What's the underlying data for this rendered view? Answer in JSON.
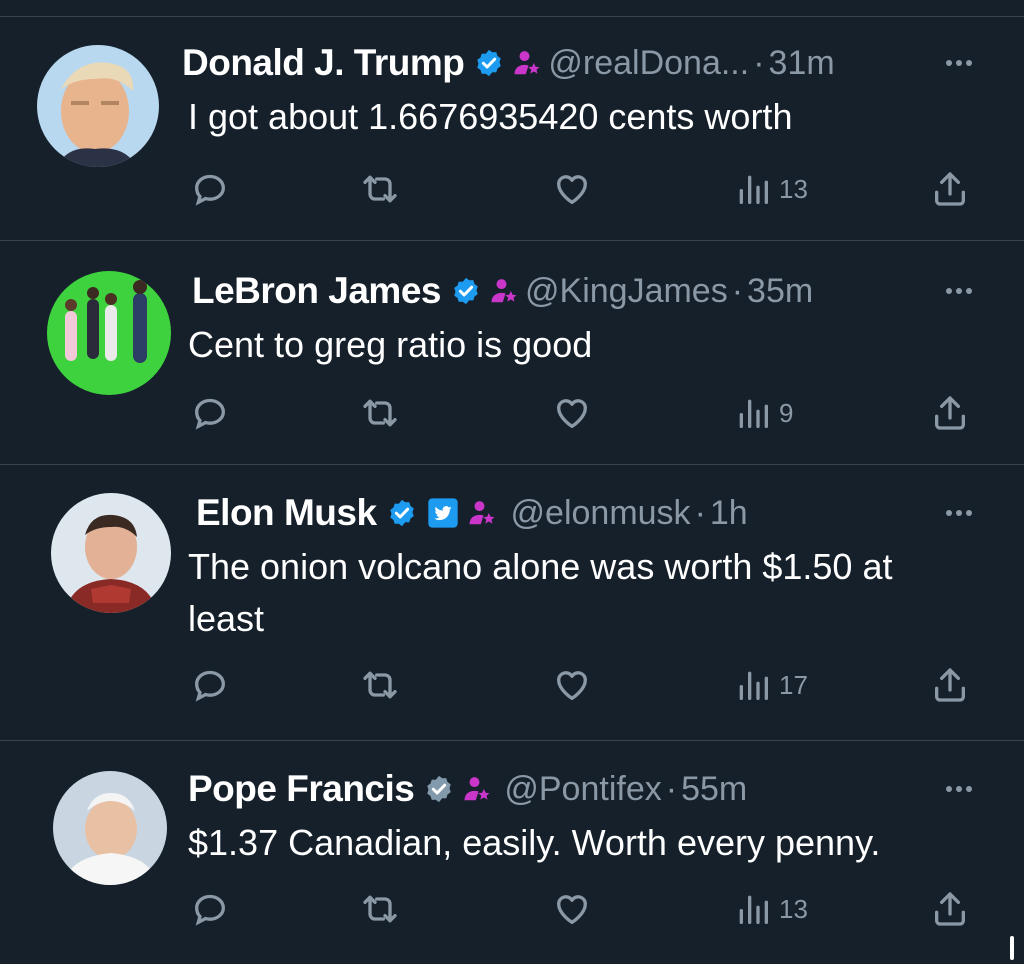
{
  "tweets": [
    {
      "name": "Donald J. Trump",
      "handle": "@realDona...",
      "separator": "·",
      "time": "31m",
      "text": "I got about 1.6676935420 cents worth",
      "views": "13",
      "avatar": "portrait-man-light-blue-background",
      "badge_color": "#1d9bf0"
    },
    {
      "name": "LeBron James",
      "handle": "@KingJames",
      "separator": "·",
      "time": "35m",
      "text": "Cent to greg ratio is good",
      "views": "9",
      "avatar": "group-photo-green-background",
      "badge_color": "#1d9bf0"
    },
    {
      "name": "Elon Musk",
      "handle": "@elonmusk",
      "separator": "·",
      "time": "1h",
      "text": "The onion volcano alone was worth $1.50 at least",
      "views": "17",
      "avatar": "portrait-man-red-armor",
      "badge_color": "#1d9bf0"
    },
    {
      "name": "Pope Francis",
      "handle": "@Pontifex",
      "separator": "·",
      "time": "55m",
      "text": "$1.37 Canadian, easily. Worth every penny.",
      "views": "13",
      "avatar": "portrait-pope-white-cap",
      "badge_color": "#829aab"
    }
  ],
  "icons": {
    "verified": "verified-badge-icon",
    "affiliate": "affiliate-person-icon",
    "twitter": "twitter-bird-icon",
    "reply": "reply-icon",
    "retweet": "retweet-icon",
    "like": "heart-icon",
    "views": "views-chart-icon",
    "share": "share-icon",
    "more": "more-dots-icon"
  },
  "colors": {
    "background": "#15202b",
    "secondary_text": "#8b98a5",
    "affiliate": "#c936c9",
    "divider": "#38444d"
  }
}
